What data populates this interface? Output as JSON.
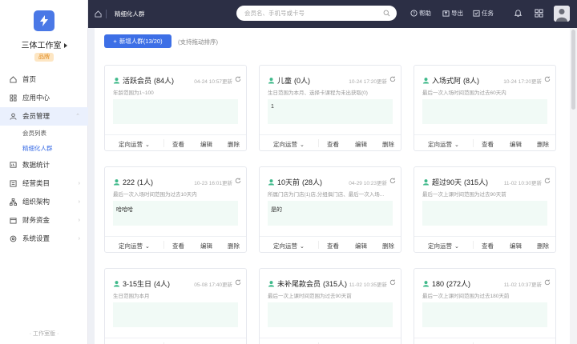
{
  "sidebar": {
    "company_name": "三体工作室",
    "badge": "品牌",
    "items": [
      {
        "label": "首页",
        "icon": "home-icon"
      },
      {
        "label": "应用中心",
        "icon": "grid-icon"
      },
      {
        "label": "会员管理",
        "icon": "user-icon"
      },
      {
        "label": "数据统计",
        "icon": "chart-icon"
      },
      {
        "label": "经营类目",
        "icon": "list-icon"
      },
      {
        "label": "组织架构",
        "icon": "org-icon"
      },
      {
        "label": "财务资金",
        "icon": "wallet-icon"
      },
      {
        "label": "系统设置",
        "icon": "gear-icon"
      }
    ],
    "sub_items": [
      "会员列表",
      "精细化人群"
    ],
    "footer": "· 工作室版 ·"
  },
  "topbar": {
    "breadcrumb": "精细化人群",
    "search_placeholder": "会员名、手机号或卡号",
    "help": "帮助",
    "export": "导出",
    "tasks": "任务"
  },
  "toolbar": {
    "add_label": "新增人群(13/20)",
    "hint": "(支持拖动排序)"
  },
  "card_actions": {
    "directed": "定向运营",
    "view": "查看",
    "edit": "编辑",
    "delete": "删除"
  },
  "cards": [
    {
      "name": "活跃会员",
      "count": "(84人)",
      "updated": "04-24 10:57更新",
      "desc": "年龄范围为1~100",
      "note": ""
    },
    {
      "name": "儿童",
      "count": "(0人)",
      "updated": "10-24 17:20更新",
      "desc": "生日范围为本月、选择卡课程为未出获取(0)",
      "note": "1"
    },
    {
      "name": "入场式阿",
      "count": "(8人)",
      "updated": "10-24 17:20更新",
      "desc": "最后一次入场时间范围为过去60天内",
      "note": ""
    },
    {
      "name": "222",
      "count": "(1人)",
      "updated": "10-23 16:01更新",
      "desc": "最后一次入场时间范围为过去10天内",
      "note": "哈哈哈"
    },
    {
      "name": "10天前",
      "count": "(28人)",
      "updated": "04-29 10:23更新",
      "desc": "所属门店为门店(1)店,分组俱门店、最后一次入场...",
      "note": "是的"
    },
    {
      "name": "超过90天",
      "count": "(315人)",
      "updated": "11-02 10:30更新",
      "desc": "最后一次上课时间范围为过去90天前",
      "note": ""
    },
    {
      "name": "3-15生日",
      "count": "(4人)",
      "updated": "05-08 17:40更新",
      "desc": "生日范围为本月",
      "note": ""
    },
    {
      "name": "未补尾款会员",
      "count": "(315人)",
      "updated": "11-02 10:35更新",
      "desc": "最后一次上课时间范围为过去90天前",
      "note": ""
    },
    {
      "name": "180",
      "count": "(272人)",
      "updated": "11-02 10:37更新",
      "desc": "最后一次上课时间范围为过去180天前",
      "note": ""
    }
  ],
  "colors": {
    "accent": "#3d6fe6",
    "topbar": "#2c2f45",
    "badge_bg": "#fde6c3",
    "badge_text": "#e0891d",
    "note_bg": "#f1faf6",
    "group_icon": "#3fb98a"
  }
}
